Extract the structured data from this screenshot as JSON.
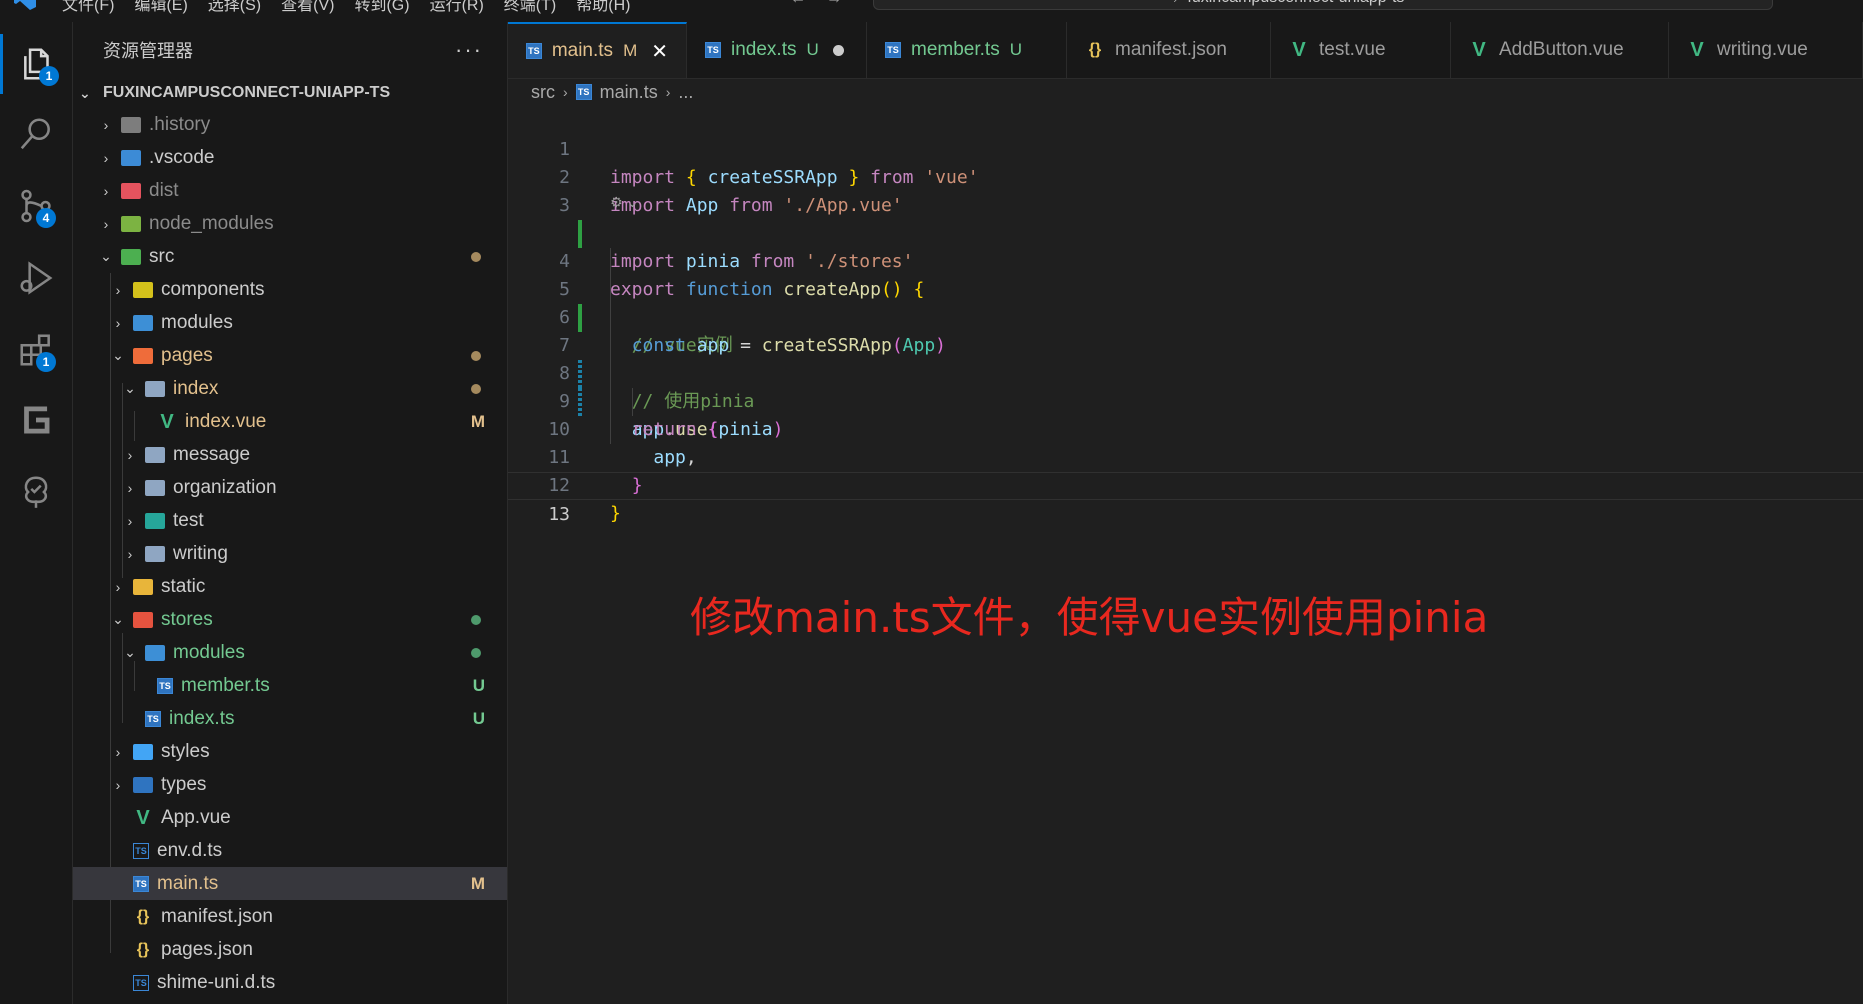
{
  "menubar": {
    "items": [
      "文件(F)",
      "编辑(E)",
      "选择(S)",
      "查看(V)",
      "转到(G)",
      "运行(R)",
      "终端(T)",
      "帮助(H)"
    ],
    "command_center": "fuxincampusconnect-uniapp-ts"
  },
  "activity": {
    "explorer_badge": "1",
    "scm_badge": "4",
    "extensions_badge": "1"
  },
  "sidebar": {
    "title": "资源管理器",
    "more": "···",
    "root": "FUXINCAMPUSCONNECT-UNIAPP-TS",
    "rows": [
      {
        "label": ".history",
        "status": ""
      },
      {
        "label": ".vscode",
        "status": ""
      },
      {
        "label": "dist",
        "status": ""
      },
      {
        "label": "node_modules",
        "status": ""
      },
      {
        "label": "src",
        "status": ""
      },
      {
        "label": "components",
        "status": ""
      },
      {
        "label": "modules",
        "status": ""
      },
      {
        "label": "pages",
        "status": ""
      },
      {
        "label": "index",
        "status": ""
      },
      {
        "label": "index.vue",
        "status": "M"
      },
      {
        "label": "message",
        "status": ""
      },
      {
        "label": "organization",
        "status": ""
      },
      {
        "label": "test",
        "status": ""
      },
      {
        "label": "writing",
        "status": ""
      },
      {
        "label": "static",
        "status": ""
      },
      {
        "label": "stores",
        "status": ""
      },
      {
        "label": "modules",
        "status": ""
      },
      {
        "label": "member.ts",
        "status": "U"
      },
      {
        "label": "index.ts",
        "status": "U"
      },
      {
        "label": "styles",
        "status": ""
      },
      {
        "label": "types",
        "status": ""
      },
      {
        "label": "App.vue",
        "status": ""
      },
      {
        "label": "env.d.ts",
        "status": ""
      },
      {
        "label": "main.ts",
        "status": "M"
      },
      {
        "label": "manifest.json",
        "status": ""
      },
      {
        "label": "pages.json",
        "status": ""
      },
      {
        "label": "shime-uni.d.ts",
        "status": ""
      }
    ]
  },
  "tabs": [
    {
      "label": "main.ts",
      "flag": "M"
    },
    {
      "label": "index.ts",
      "flag": "U"
    },
    {
      "label": "member.ts",
      "flag": "U"
    },
    {
      "label": "manifest.json",
      "flag": ""
    },
    {
      "label": "test.vue",
      "flag": ""
    },
    {
      "label": "AddButton.vue",
      "flag": ""
    },
    {
      "label": "writing.vue",
      "flag": ""
    }
  ],
  "breadcrumb": {
    "folder": "src",
    "file": "main.ts",
    "rest": "..."
  },
  "editor": {
    "line_numbers": [
      "1",
      "2",
      "3",
      "4",
      "5",
      "6",
      "7",
      "8",
      "9",
      "10",
      "11",
      "12",
      "13"
    ]
  },
  "annotation": "修改main.ts文件，使得vue实例使用pinia"
}
